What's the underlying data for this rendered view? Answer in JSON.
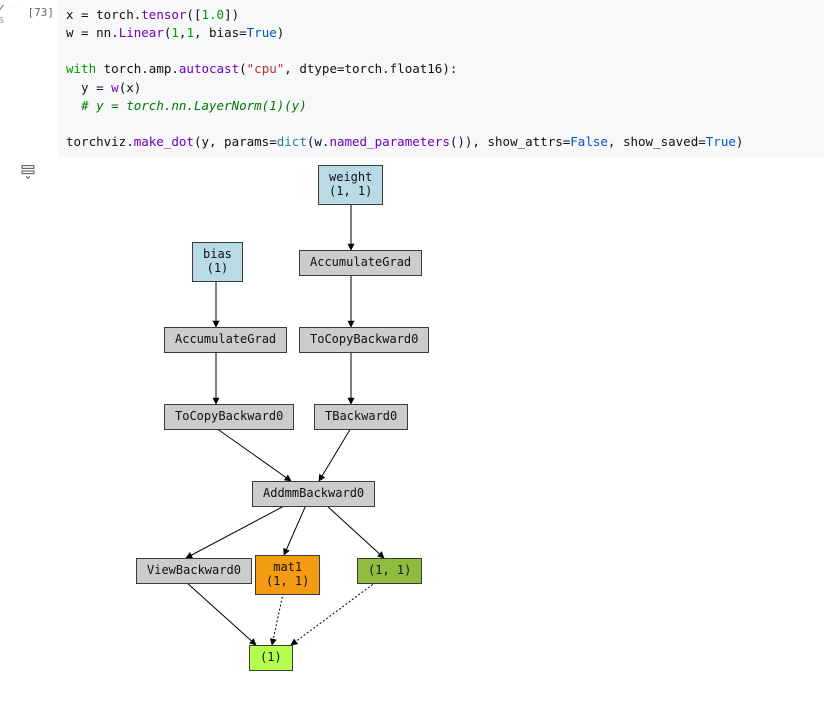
{
  "cell": {
    "execution_count": "[73]",
    "status_primary": "✓",
    "status_secondary": "s",
    "code": {
      "l1a": "x = torch.",
      "l1b": "tensor",
      "l1c": "([",
      "l1d": "1.0",
      "l1e": "])",
      "l2a": "w = nn.",
      "l2b": "Linear",
      "l2c": "(",
      "l2d": "1",
      "l2e": ",",
      "l2f": "1",
      "l2g": ", bias=",
      "l2h": "True",
      "l2i": ")",
      "l3": "",
      "l4a": "with",
      "l4b": " torch.amp.",
      "l4c": "autocast",
      "l4d": "(",
      "l4e": "\"cpu\"",
      "l4f": ", dtype=torch.float16):",
      "l5a": "  y = ",
      "l5b": "w",
      "l5c": "(x)",
      "l6a": "  ",
      "l6b": "# y = torch.nn.LayerNorm(1)(y)",
      "l7": "",
      "l8a": "torchviz.",
      "l8b": "make_dot",
      "l8c": "(y, params=",
      "l8d": "dict",
      "l8e": "(w.",
      "l8f": "named_parameters",
      "l8g": "()), show_attrs=",
      "l8h": "False",
      "l8i": ", show_saved=",
      "l8j": "True",
      "l8k": ")"
    }
  },
  "graph": {
    "nodes": {
      "weight": {
        "label_top": "weight",
        "label_bot": "(1, 1)"
      },
      "bias": {
        "label_top": "bias",
        "label_bot": "(1)"
      },
      "accgrad_w": {
        "label": "AccumulateGrad"
      },
      "accgrad_b": {
        "label": "AccumulateGrad"
      },
      "tocopy_w": {
        "label": "ToCopyBackward0"
      },
      "tocopy_b": {
        "label": "ToCopyBackward0"
      },
      "tback": {
        "label": "TBackward0"
      },
      "addmm": {
        "label": "AddmmBackward0"
      },
      "viewb": {
        "label": "ViewBackward0"
      },
      "mat1": {
        "label_top": "mat1",
        "label_bot": "(1, 1)"
      },
      "interm": {
        "label": "(1, 1)"
      },
      "out": {
        "label": "(1)"
      }
    }
  }
}
